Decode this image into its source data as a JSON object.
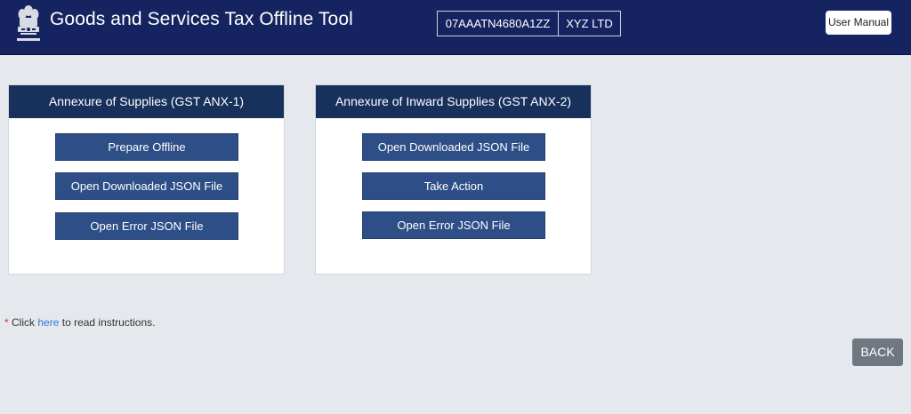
{
  "header": {
    "title": "Goods and Services Tax Offline Tool",
    "gstin": "07AAATN4680A1ZZ",
    "company": "XYZ LTD",
    "manual_label": "User Manual",
    "emblem_icon": "national-emblem-icon"
  },
  "cards": [
    {
      "title": "Annexure of Supplies (GST ANX-1)",
      "buttons": [
        "Prepare Offline",
        "Open Downloaded JSON File",
        "Open Error JSON File"
      ]
    },
    {
      "title": "Annexure of Inward Supplies (GST ANX-2)",
      "buttons": [
        "Open Downloaded JSON File",
        "Take Action",
        "Open Error JSON File"
      ]
    }
  ],
  "note": {
    "asterisk": "*",
    "prefix": "Click",
    "link": "here",
    "suffix": "to read instructions."
  },
  "back_label": "BACK",
  "colors": {
    "header_bg": "#152460",
    "card_header_bg": "#17305c",
    "button_bg": "#2d4e86",
    "page_bg": "#e5e8ec",
    "back_bg": "#6f7781",
    "link": "#2f7ad6"
  }
}
